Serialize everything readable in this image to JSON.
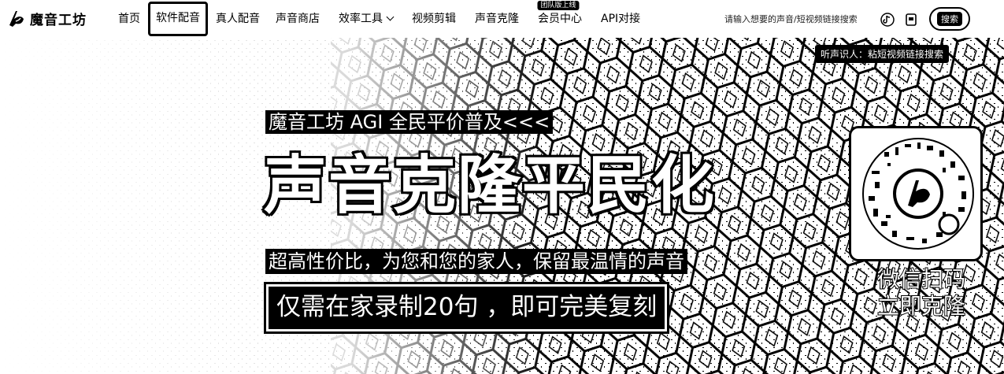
{
  "brand": {
    "name": "魔音工坊"
  },
  "nav": {
    "items": [
      {
        "label": "首页"
      },
      {
        "label": "软件配音"
      },
      {
        "label": "真人配音"
      },
      {
        "label": "声音商店"
      },
      {
        "label": "效率工具"
      },
      {
        "label": "视频剪辑"
      },
      {
        "label": "声音克隆"
      },
      {
        "label": "会员中心",
        "badge": "团队版上线"
      },
      {
        "label": "API对接"
      }
    ]
  },
  "search": {
    "placeholder": "请输入想要的声音/短视频链接搜索",
    "button_label": "搜索",
    "tooltip": "听声识人：粘短视频链接搜索"
  },
  "hero": {
    "subtitle": "魔音工坊 AGI 全民平价普及<<<",
    "title": "声音克隆平民化",
    "slogan": "超高性价比，为您和您的家人，保留最温情的声音",
    "cta": "仅需在家录制20句 ，即可完美复刻",
    "qr_caption_line1": "微信扫码",
    "qr_caption_line2": "立即克隆"
  },
  "colors": {
    "accent": "#000000",
    "background": "#ffffff"
  },
  "icons": [
    "logo-icon",
    "chevron-down-icon",
    "tiktok-icon",
    "mini-app-icon",
    "qr-code-icon"
  ]
}
